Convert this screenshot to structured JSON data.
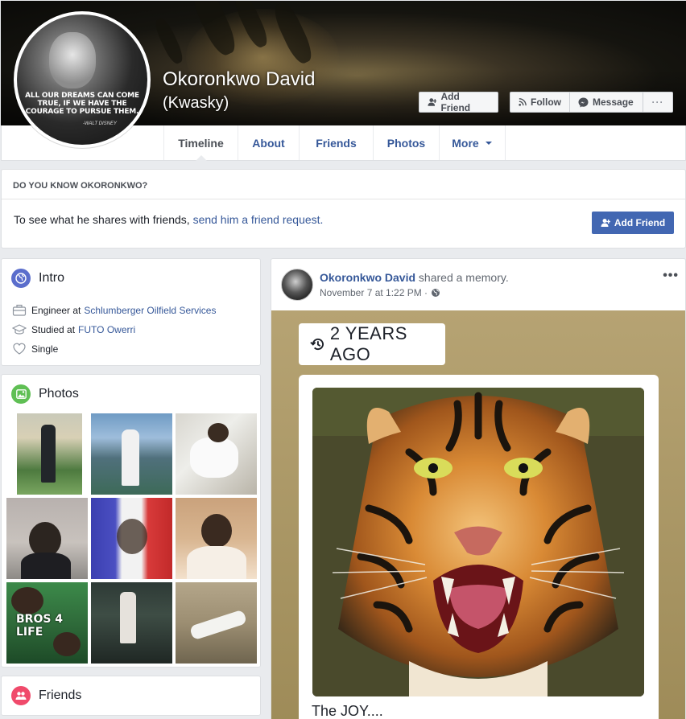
{
  "profile": {
    "name": "Okoronkwo David",
    "alt_name": "(Kwasky)",
    "picture_quote": "ALL OUR DREAMS CAN COME TRUE, IF WE HAVE THE COURAGE TO PURSUE THEM.",
    "picture_signature": "-WALT DISNEY"
  },
  "actions": {
    "add_friend": "Add Friend",
    "follow": "Follow",
    "message": "Message",
    "more": "···"
  },
  "nav": {
    "tabs": [
      "Timeline",
      "About",
      "Friends",
      "Photos",
      "More"
    ],
    "active": "Timeline"
  },
  "know_box": {
    "heading": "DO YOU KNOW OKORONKWO?",
    "text": "To see what he shares with friends,",
    "link": "send him a friend request.",
    "button": "Add Friend"
  },
  "intro": {
    "title": "Intro",
    "work_prefix": "Engineer at",
    "work_link": "Schlumberger Oilfield Services",
    "study_prefix": "Studied at",
    "study_link": "FUTO Owerri",
    "relationship": "Single"
  },
  "photos": {
    "title": "Photos",
    "overlay_text": "BROS 4 LIFE"
  },
  "friends": {
    "title": "Friends"
  },
  "post": {
    "author": "Okoronkwo David",
    "action": "shared a memory.",
    "timestamp": "November 7 at 1:22 PM ·",
    "more": "•••",
    "badge": "2 YEARS AGO",
    "caption": "The JOY...."
  },
  "colors": {
    "link": "#365899",
    "button_blue": "#4267b2",
    "background": "#e9ebee",
    "intro_icon": "#5b6ecc",
    "photos_icon": "#5fbf54",
    "friends_icon": "#f04a6b"
  }
}
